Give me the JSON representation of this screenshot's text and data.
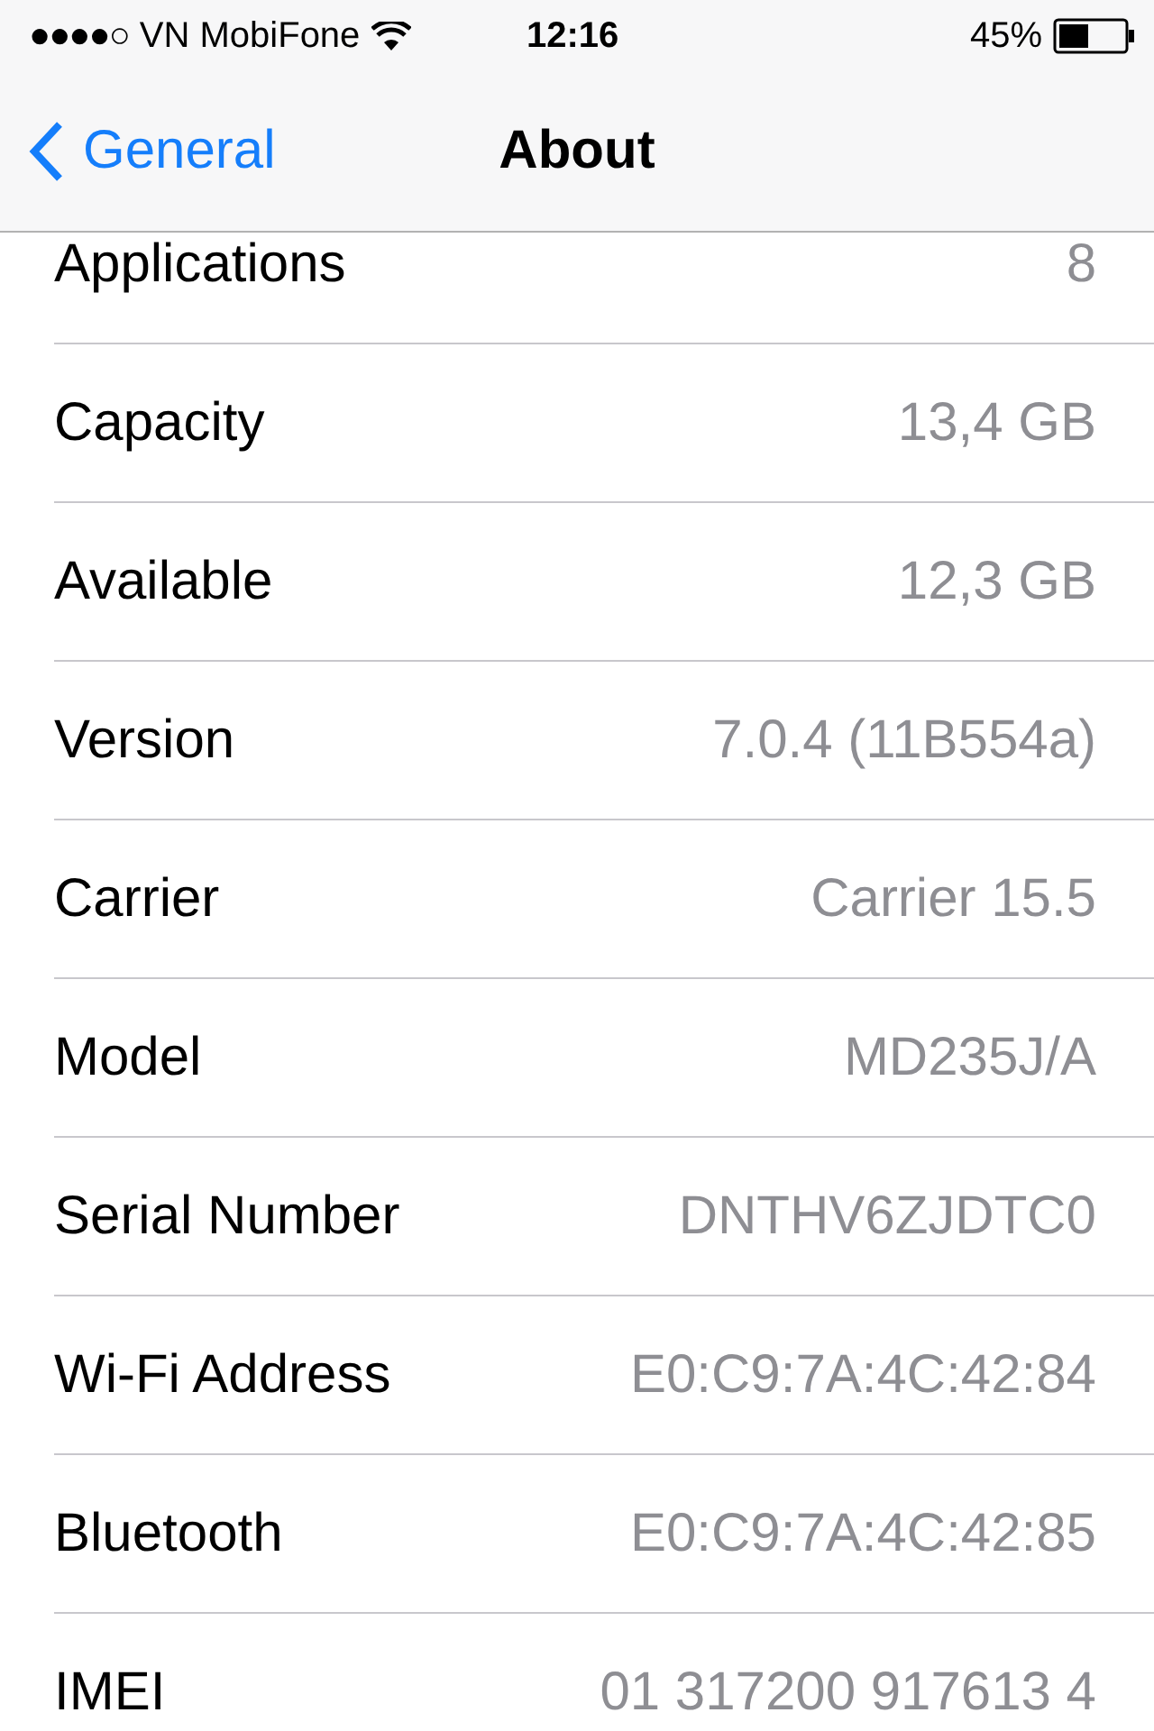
{
  "status_bar": {
    "signal": "●●●●○",
    "carrier": "VN MobiFone",
    "time": "12:16",
    "battery": "45%"
  },
  "nav_bar": {
    "back": "General",
    "title": "About"
  },
  "rows": [
    {
      "label": "Applications",
      "value": "8"
    },
    {
      "label": "Capacity",
      "value": "13,4 GB"
    },
    {
      "label": "Available",
      "value": "12,3 GB"
    },
    {
      "label": "Version",
      "value": "7.0.4 (11B554a)"
    },
    {
      "label": "Carrier",
      "value": "Carrier 15.5"
    },
    {
      "label": "Model",
      "value": "MD235J/A"
    },
    {
      "label": "Serial Number",
      "value": "DNTHV6ZJDTC0"
    },
    {
      "label": "Wi-Fi Address",
      "value": "E0:C9:7A:4C:42:84"
    },
    {
      "label": "Bluetooth",
      "value": "E0:C9:7A:4C:42:85"
    },
    {
      "label": "IMEI",
      "value": "01 317200 917613 4"
    }
  ]
}
